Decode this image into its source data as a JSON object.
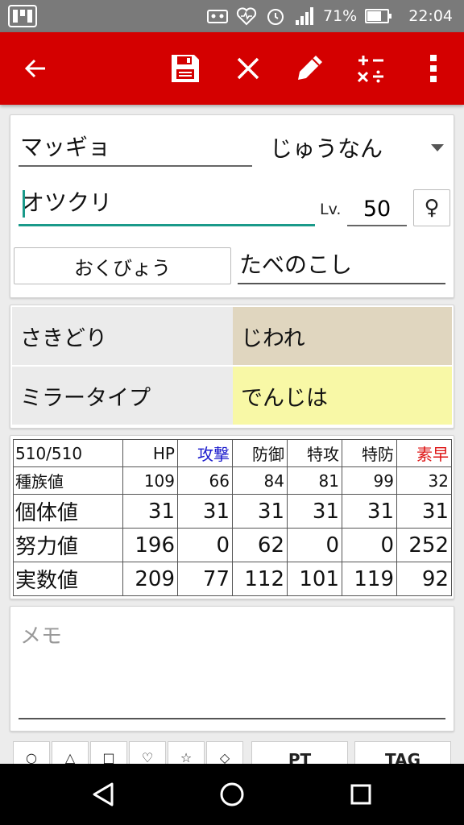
{
  "status_bar": {
    "battery_percent": "71%",
    "battery_level": 0.71,
    "time": "22:04"
  },
  "toolbar": {
    "icons": [
      "back-arrow-icon",
      "save-icon",
      "close-icon",
      "edit-pencil-icon",
      "calculator-icon",
      "more-vert-icon"
    ],
    "color": "#d40000"
  },
  "form": {
    "pokemon": "マッギョ",
    "ability": "じゅうなん",
    "nickname": "オツクリ",
    "level_label": "Lv.",
    "level": "50",
    "gender": "♀",
    "nature": "おくびょう",
    "item": "たべのこし"
  },
  "moves": [
    {
      "name": "さきどり",
      "color": "#ebebeb"
    },
    {
      "name": "じわれ",
      "color": "#e0d6bf"
    },
    {
      "name": "ミラータイプ",
      "color": "#ebebeb"
    },
    {
      "name": "でんじは",
      "color": "#f8f8a6"
    }
  ],
  "stats": {
    "ev_total": "510/510",
    "headers": [
      {
        "label": "HP",
        "color": "#111111"
      },
      {
        "label": "攻撃",
        "color": "#1a1acc"
      },
      {
        "label": "防御",
        "color": "#111111"
      },
      {
        "label": "特攻",
        "color": "#111111"
      },
      {
        "label": "特防",
        "color": "#111111"
      },
      {
        "label": "素早",
        "color": "#dd1111"
      }
    ],
    "rows": [
      {
        "label": "種族値",
        "values": [
          "109",
          "66",
          "84",
          "81",
          "99",
          "32"
        ]
      },
      {
        "label": "個体値",
        "values": [
          "31",
          "31",
          "31",
          "31",
          "31",
          "31"
        ]
      },
      {
        "label": "努力値",
        "values": [
          "196",
          "0",
          "62",
          "0",
          "0",
          "252"
        ]
      },
      {
        "label": "実数値",
        "values": [
          "209",
          "77",
          "112",
          "101",
          "119",
          "92"
        ]
      }
    ]
  },
  "memo": {
    "placeholder": "メモ",
    "value": ""
  },
  "markbar": {
    "marks": [
      "○",
      "△",
      "□",
      "♡",
      "☆",
      "◇"
    ],
    "pt_label": "PT",
    "tag_label": "TAG"
  },
  "nav": {
    "icons": [
      "back-triangle-icon",
      "home-circle-icon",
      "recents-square-icon"
    ]
  }
}
